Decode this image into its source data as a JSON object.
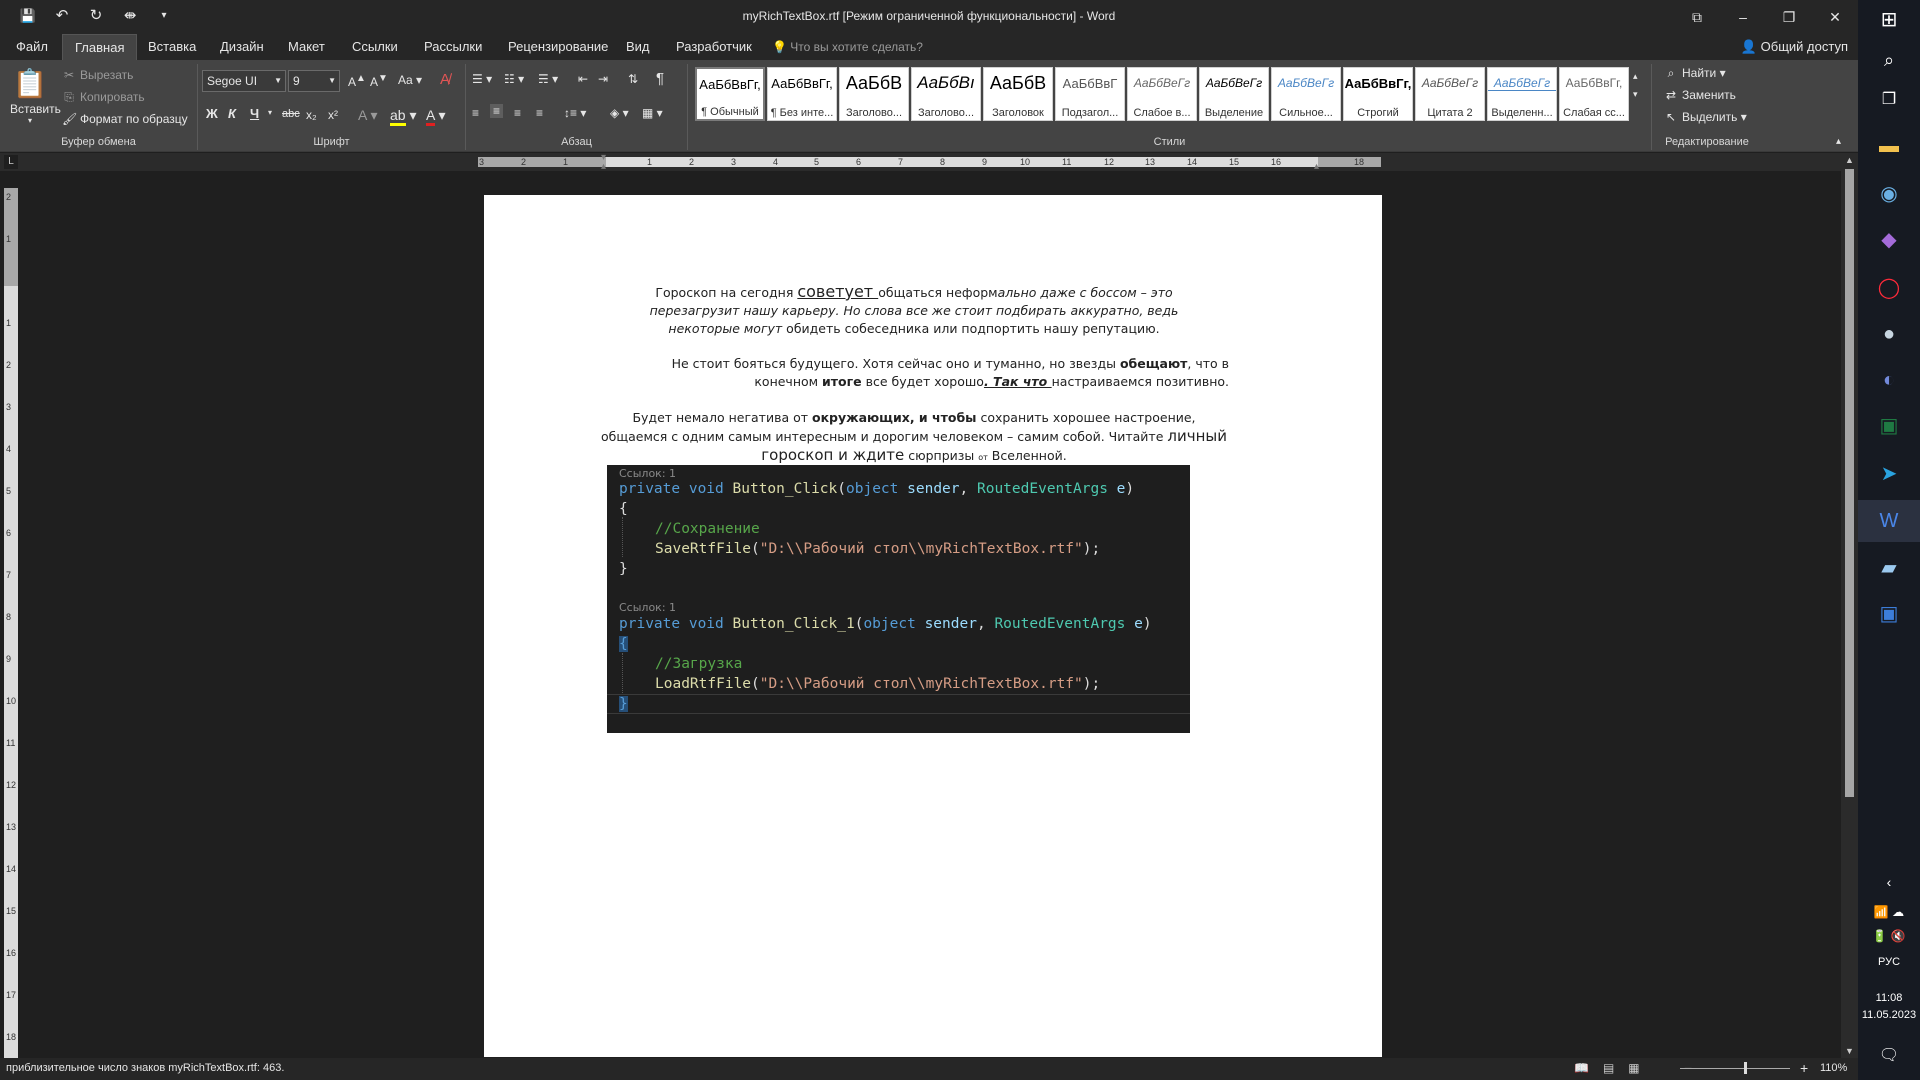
{
  "window": {
    "title": "myRichTextBox.rtf [Режим ограниченной функциональности] - Word",
    "controls": [
      "–",
      "❐",
      "✕"
    ],
    "restore_ribbon": "⧉"
  },
  "qat": {
    "save": "💾",
    "undo": "↶",
    "redo": "↻",
    "custom": "⇼",
    "more": "▾"
  },
  "tabs": {
    "file": "Файл",
    "items": [
      "Главная",
      "Вставка",
      "Дизайн",
      "Макет",
      "Ссылки",
      "Рассылки",
      "Рецензирование",
      "Вид",
      "Разработчик"
    ],
    "active": "Главная",
    "tell_me": "Что вы хотите сделать?",
    "share": "Общий доступ"
  },
  "ribbon": {
    "clipboard": {
      "label": "Буфер обмена",
      "paste": "Вставить",
      "cut": "Вырезать",
      "copy": "Копировать",
      "format_painter": "Формат по образцу"
    },
    "font": {
      "label": "Шрифт",
      "font_name": "Segoe UI",
      "font_size": "9",
      "bold": "Ж",
      "italic": "К",
      "underline": "Ч",
      "strike": "abc",
      "sub": "x₂",
      "sup": "x²",
      "case": "Aa"
    },
    "paragraph": {
      "label": "Абзац"
    },
    "styles": {
      "label": "Стили",
      "items": [
        {
          "preview": "АаБбВвГг,",
          "name": "¶ Обычный"
        },
        {
          "preview": "АаБбВвГг,",
          "name": "¶ Без инте..."
        },
        {
          "preview": "АаБбВ",
          "name": "Заголово..."
        },
        {
          "preview": "АаБбВı",
          "name": "Заголово..."
        },
        {
          "preview": "АаБбВ",
          "name": "Заголовок"
        },
        {
          "preview": "АаБбВвГ",
          "name": "Подзагол..."
        },
        {
          "preview": "АаБбВеГг",
          "name": "Слабое в..."
        },
        {
          "preview": "АаБбВеГг",
          "name": "Выделение"
        },
        {
          "preview": "АаБбВеГг",
          "name": "Сильное..."
        },
        {
          "preview": "АаБбВвГг,",
          "name": "Строгий"
        },
        {
          "preview": "АаБбВеГг",
          "name": "Цитата 2"
        },
        {
          "preview": "АаБбВеГг",
          "name": "Выделенн..."
        },
        {
          "preview": "АаБбВвГг,",
          "name": "Слабая сс..."
        }
      ]
    },
    "editing": {
      "label": "Редактирование",
      "find": "Найти",
      "replace": "Заменить",
      "select": "Выделить"
    }
  },
  "ruler": {
    "h_numbers": [
      "3",
      "2",
      "1",
      "1",
      "2",
      "3",
      "4",
      "5",
      "6",
      "7",
      "8",
      "9",
      "10",
      "11",
      "12",
      "13",
      "14",
      "15",
      "16",
      "18"
    ],
    "v_numbers": [
      "2",
      "1",
      "1",
      "2",
      "3",
      "4",
      "5",
      "6",
      "7",
      "8",
      "9",
      "10",
      "11",
      "12",
      "13",
      "14",
      "15",
      "16",
      "17",
      "18"
    ],
    "tab_selector": "L"
  },
  "document": {
    "p1": {
      "a": "Гороскоп на сегодня ",
      "b": "советует ",
      "c": "общаться неформ",
      "d": "ально даже с боссом – это перезагрузит нашу карьеру. Но слова все же стоит подбирать аккуратно, ведь некоторые могут",
      "e": " обидеть собеседника или подпортить нашу репутацию."
    },
    "p2": {
      "a": "Не стоит бояться будущего. Хотя сейчас оно и туманно, но звезды ",
      "b": "обещают",
      "c": ", что в конечном ",
      "d": "итоге",
      "e": " все будет хорошо",
      "f": ". Так что ",
      "g": "настраиваемся позитивно."
    },
    "p3": {
      "a": "Будет немало негатива от ",
      "b": "окружающих, и чтобы",
      "c": " сохранить хорошее настроение, общаемся с одним самым интересным и дорогим человеком – самим собой. Читайте ",
      "d": "личный гороскоп и ждите",
      "e": " сюрпризы ",
      "f": "от",
      "g": " Вселенной."
    },
    "code": {
      "ref1": "Ссылок: 1",
      "m1_private": "private",
      "m1_void": "void",
      "m1_name": "Button_Click",
      "m1_open": "(",
      "m1_object": "object",
      "m1_sender": "sender",
      "m1_comma": ", ",
      "m1_args": "RoutedEventArgs",
      "m1_e": "e",
      "m1_close": ")",
      "brace_open": "{",
      "brace_close": "}",
      "c1": "//Сохранение",
      "call1_name": "SaveRtfFile",
      "call_open": "(",
      "call_str": "\"D:\\\\Рабочий стол\\\\myRichTextBox.rtf\"",
      "call_close": ");",
      "ref2": "Ссылок: 1",
      "m2_name": "Button_Click_1",
      "c2": "//Загрузка",
      "call2_name": "LoadRtfFile"
    }
  },
  "status": {
    "text": "приблизительное число знаков myRichTextBox.rtf: 463.",
    "zoom": "110%"
  },
  "taskbar": {
    "lang": "РУС",
    "time": "11:08",
    "date": "11.05.2023"
  },
  "colors": {
    "keyword": "#569cd6",
    "method": "#dcdcaa",
    "type": "#4ec9b0",
    "param": "#9cdcfe",
    "comment": "#57a64a",
    "string": "#d69d85"
  }
}
